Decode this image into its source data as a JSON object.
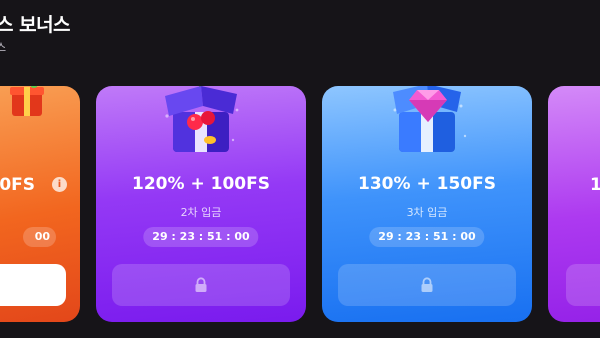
{
  "header": {
    "title": "스 보너스",
    "subtitle": "스"
  },
  "cards": [
    {
      "offer": "0FS",
      "timer_tail": "00",
      "color": "#f2661f",
      "icon": "info-icon"
    },
    {
      "offer": "120% + 100FS",
      "deposit": "2차 입금",
      "timer": "29 : 23 : 51 : 00",
      "color": "#9439f5",
      "gift_icon": "cherry-gift-icon",
      "button_icon": "lock-icon"
    },
    {
      "offer": "130% + 150FS",
      "deposit": "3차 입금",
      "timer": "29 : 23 : 51 : 00",
      "color": "#3f93fb",
      "gift_icon": "diamond-gift-icon",
      "button_icon": "lock-icon"
    },
    {
      "offer": "1",
      "color": "#ad3af0"
    }
  ],
  "colors": {
    "background": "#161418"
  }
}
